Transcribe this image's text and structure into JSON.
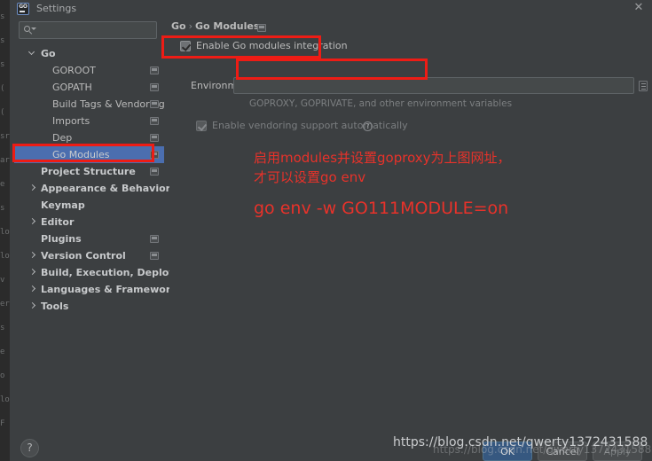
{
  "window": {
    "title": "Settings",
    "app_icon": "goland-go-icon",
    "close_icon": "close-icon"
  },
  "search": {
    "placeholder": "",
    "value": "",
    "icon": "search-icon"
  },
  "sidebar": {
    "items": [
      {
        "label": "Go",
        "level": 0,
        "arrow": "down",
        "bold": true,
        "scope_icon": false,
        "selected": false
      },
      {
        "label": "GOROOT",
        "level": 1,
        "arrow": "none",
        "bold": false,
        "scope_icon": true,
        "selected": false
      },
      {
        "label": "GOPATH",
        "level": 1,
        "arrow": "none",
        "bold": false,
        "scope_icon": true,
        "selected": false
      },
      {
        "label": "Build Tags & Vendoring",
        "level": 1,
        "arrow": "none",
        "bold": false,
        "scope_icon": true,
        "selected": false
      },
      {
        "label": "Imports",
        "level": 1,
        "arrow": "none",
        "bold": false,
        "scope_icon": true,
        "selected": false
      },
      {
        "label": "Dep",
        "level": 1,
        "arrow": "none",
        "bold": false,
        "scope_icon": true,
        "selected": false
      },
      {
        "label": "Go Modules",
        "level": 1,
        "arrow": "none",
        "bold": false,
        "scope_icon": true,
        "selected": true
      },
      {
        "label": "Project Structure",
        "level": 0,
        "arrow": "none",
        "bold": true,
        "scope_icon": true,
        "selected": false
      },
      {
        "label": "Appearance & Behavior",
        "level": 0,
        "arrow": "right",
        "bold": true,
        "scope_icon": false,
        "selected": false
      },
      {
        "label": "Keymap",
        "level": 0,
        "arrow": "none",
        "bold": true,
        "scope_icon": false,
        "selected": false
      },
      {
        "label": "Editor",
        "level": 0,
        "arrow": "right",
        "bold": true,
        "scope_icon": false,
        "selected": false
      },
      {
        "label": "Plugins",
        "level": 0,
        "arrow": "none",
        "bold": true,
        "scope_icon": true,
        "selected": false
      },
      {
        "label": "Version Control",
        "level": 0,
        "arrow": "right",
        "bold": true,
        "scope_icon": true,
        "selected": false
      },
      {
        "label": "Build, Execution, Deployment",
        "level": 0,
        "arrow": "right",
        "bold": true,
        "scope_icon": false,
        "selected": false
      },
      {
        "label": "Languages & Frameworks",
        "level": 0,
        "arrow": "right",
        "bold": true,
        "scope_icon": false,
        "selected": false
      },
      {
        "label": "Tools",
        "level": 0,
        "arrow": "right",
        "bold": true,
        "scope_icon": false,
        "selected": false
      }
    ]
  },
  "main": {
    "breadcrumb_root": "Go",
    "breadcrumb_separator": "›",
    "breadcrumb_current": "Go Modules",
    "enable_modules_label": "Enable Go modules integration",
    "enable_modules_checked": true,
    "environment_label": "Environment:",
    "environment_value": "",
    "environment_hint": "GOPROXY, GOPRIVATE, and other environment variables",
    "vendoring_label": "Enable vendoring support automatically",
    "vendoring_checked": true,
    "vendoring_disabled": true,
    "vendoring_help_icon": "question-mark-icon"
  },
  "annotations": {
    "line1": "启用modules并设置goproxy为上图网址，",
    "line2": "才可以设置go env",
    "line3": "go env -w GO111MODULE=on"
  },
  "footer": {
    "help_label": "?",
    "ok_label": "OK",
    "cancel_label": "Cancel",
    "apply_label": "Apply"
  },
  "watermark": {
    "primary": "https://blog.csdn.net/qwerty1372431588",
    "secondary": "https://blog.csdn.net/qwerty1372431588"
  },
  "background_fragments": [
    "s",
    "s",
    "s",
    "(",
    "(",
    "sr",
    "ar",
    "e",
    "s",
    "lo",
    "lo",
    "v",
    "er",
    "s",
    "e",
    "o",
    "lo",
    "F"
  ],
  "colors": {
    "dialog_bg": "#3c3f41",
    "panel_bg": "#45494a",
    "selection_blue": "#4b6eaf",
    "annotation_red": "#e8322a",
    "highlight_red": "#ee1c15",
    "text": "#bbbbbb",
    "primary_button": "#365880"
  }
}
